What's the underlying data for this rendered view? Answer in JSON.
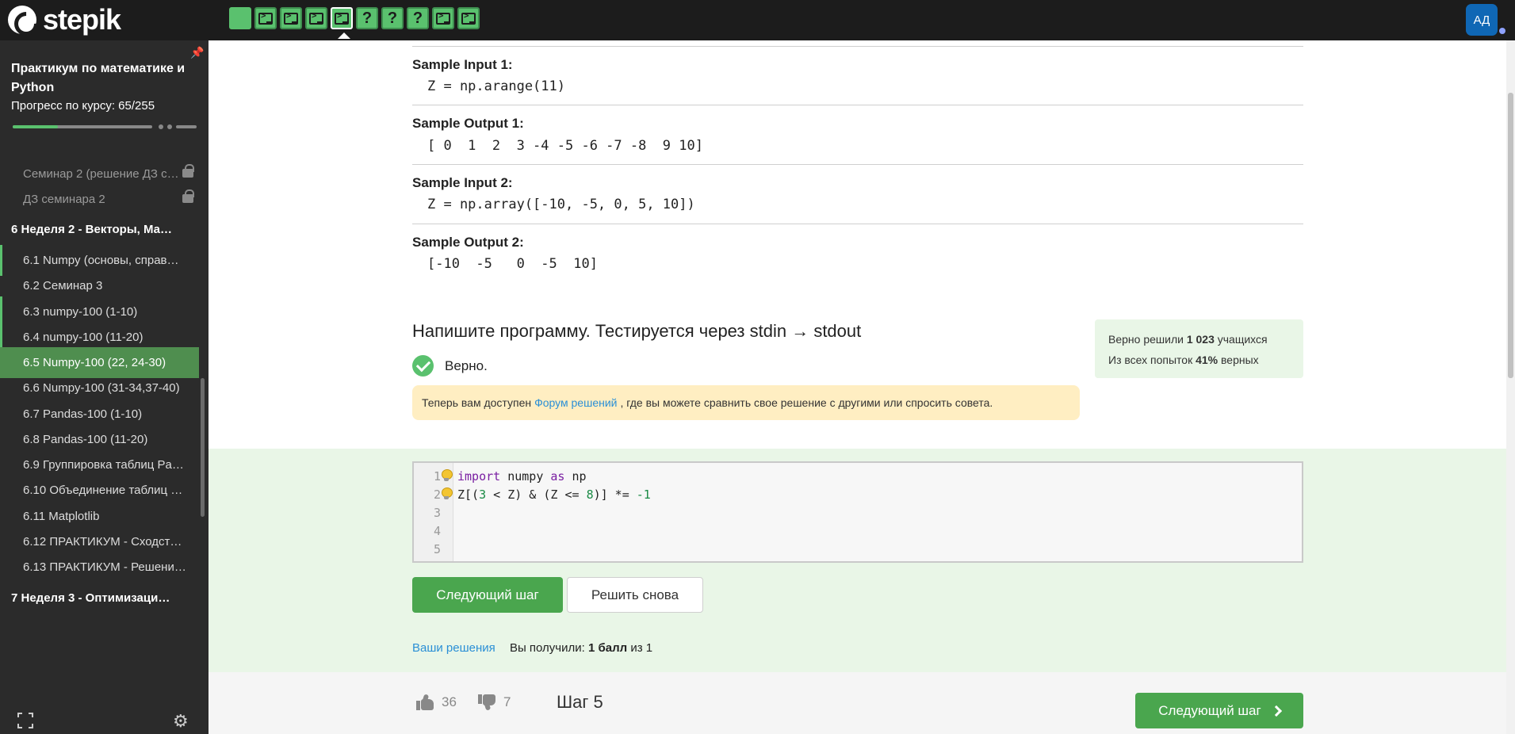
{
  "topbar": {
    "logo_text": "stepik",
    "steps": [
      {
        "kind": "text"
      },
      {
        "kind": "code"
      },
      {
        "kind": "code"
      },
      {
        "kind": "code"
      },
      {
        "kind": "code",
        "active": true
      },
      {
        "kind": "quiz",
        "label": "?"
      },
      {
        "kind": "quiz",
        "label": "?"
      },
      {
        "kind": "quiz",
        "label": "?"
      },
      {
        "kind": "code"
      },
      {
        "kind": "code"
      }
    ],
    "avatar_initials": "АД"
  },
  "sidebar": {
    "course_title": "Практикум по математике и Python",
    "progress_label": "Прогресс по курсу:",
    "progress_value": "65/255",
    "progress_fraction": 0.255,
    "items": [
      {
        "label": "Семинар 2 (решение ДЗ с…",
        "locked": true
      },
      {
        "label": "ДЗ семинара 2",
        "locked": true
      },
      {
        "label": "6  Неделя 2 - Векторы, Ма…",
        "section": true
      },
      {
        "label": "6.1  Numpy (основы, справ…",
        "done": true
      },
      {
        "label": "6.2  Семинар 3",
        "done": false
      },
      {
        "label": "6.3  numpy-100 (1-10)",
        "done": true
      },
      {
        "label": "6.4  numpy-100 (11-20)",
        "done": true
      },
      {
        "label": "6.5  Numpy-100 (22, 24-30)",
        "current": true
      },
      {
        "label": "6.6  Numpy-100 (31-34,37-40)",
        "done": false
      },
      {
        "label": "6.7  Pandas-100 (1-10)",
        "done": false
      },
      {
        "label": "6.8  Pandas-100 (11-20)",
        "done": false
      },
      {
        "label": "6.9  Группировка таблиц Pa…",
        "done": false
      },
      {
        "label": "6.10  Объединение таблиц …",
        "done": false
      },
      {
        "label": "6.11  Matplotlib",
        "done": false
      },
      {
        "label": "6.12  ПРАКТИКУМ - Сходст…",
        "done": false
      },
      {
        "label": "6.13  ПРАКТИКУМ - Решени…",
        "done": false
      },
      {
        "label": "7  Неделя 3 - Оптимизация…",
        "section": true
      }
    ]
  },
  "samples": [
    {
      "label": "Sample Input 1:",
      "code": "Z = np.arange(11)"
    },
    {
      "label": "Sample Output 1:",
      "code": "[ 0  1  2  3 -4 -5 -6 -7 -8  9 10]"
    },
    {
      "label": "Sample Input 2:",
      "code": "Z = np.array([-10, -5, 0, 5, 10])"
    },
    {
      "label": "Sample Output 2:",
      "code": "[-10  -5   0  -5  10]"
    }
  ],
  "task": {
    "title": "Напишите программу. Тестируется через stdin → stdout",
    "verdict": "Верно.",
    "forum_prefix": "Теперь вам доступен",
    "forum_link": "Форум решений",
    "forum_suffix": ", где вы можете сравнить свое решение с другими или спросить совета.",
    "stats_line1_prefix": "Верно решили",
    "stats_solved": "1 023",
    "stats_line1_suffix": "учащихся",
    "stats_line2_prefix": "Из всех попыток",
    "stats_percent": "41%",
    "stats_line2_suffix": "верных"
  },
  "editor": {
    "line_numbers": [
      "1",
      "2",
      "3",
      "4",
      "5"
    ],
    "line1": {
      "kw1": "import",
      "mod": " numpy ",
      "kw2": "as",
      "alias": " np"
    },
    "line2": {
      "a": "Z[(",
      "n1": "3",
      "b": " < Z) & (Z <= ",
      "n2": "8",
      "c": ")] *= ",
      "n3": "-1"
    }
  },
  "actions": {
    "next_step": "Следующий шаг",
    "solve_again": "Решить снова",
    "your_solutions": "Ваши решения",
    "score_prefix": "Вы получили:",
    "score_value": "1 балл",
    "score_suffix": "из 1"
  },
  "footer": {
    "likes": "36",
    "dislikes": "7",
    "step_label": "Шаг 5",
    "next_step": "Следующий шаг"
  },
  "colors": {
    "accent_green": "#4aa64e",
    "topbar_bg": "#1c1c1c",
    "sidebar_bg": "#2b2b2b",
    "solution_bg": "#e9f6e7",
    "note_bg": "#ffeec2",
    "link": "#2a8fd6"
  }
}
